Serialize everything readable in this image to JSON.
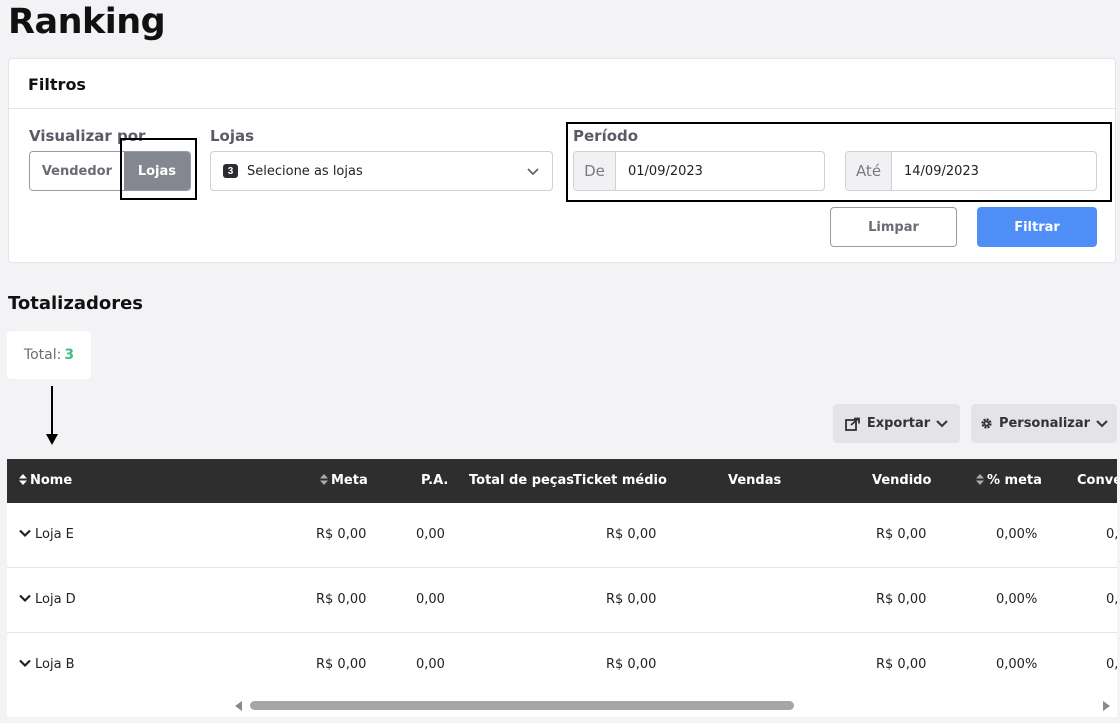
{
  "page": {
    "title": "Ranking"
  },
  "filters": {
    "header": "Filtros",
    "visualizar": {
      "label": "Visualizar por",
      "options": [
        "Vendedor",
        "Lojas"
      ],
      "selected": "Lojas"
    },
    "lojas": {
      "label": "Lojas",
      "count": "3",
      "placeholder": "Selecione as lojas"
    },
    "periodo": {
      "label": "Período",
      "from_prefix": "De",
      "from_value": "01/09/2023",
      "to_prefix": "Até",
      "to_value": "14/09/2023"
    },
    "clear_label": "Limpar",
    "filter_label": "Filtrar"
  },
  "totalizadores": {
    "title": "Totalizadores",
    "total_label": "Total:",
    "total_value": "3"
  },
  "toolbar": {
    "export_label": "Exportar",
    "customize_label": "Personalizar"
  },
  "table": {
    "headers": {
      "nome": "Nome",
      "meta": "Meta",
      "pa": "P.A.",
      "total_pecas": "Total de peças",
      "ticket_medio": "Ticket médio",
      "vendas": "Vendas",
      "vendido": "Vendido",
      "pct_meta": "% meta",
      "conversao": "Conve"
    },
    "rows": [
      {
        "nome": "Loja E",
        "meta": "R$ 0,00",
        "pa": "0,00",
        "ticket_medio": "R$ 0,00",
        "vendido": "R$ 0,00",
        "pct_meta": "0,00%",
        "conversao": "0,"
      },
      {
        "nome": "Loja D",
        "meta": "R$ 0,00",
        "pa": "0,00",
        "ticket_medio": "R$ 0,00",
        "vendido": "R$ 0,00",
        "pct_meta": "0,00%",
        "conversao": "0,"
      },
      {
        "nome": "Loja B",
        "meta": "R$ 0,00",
        "pa": "0,00",
        "ticket_medio": "R$ 0,00",
        "vendido": "R$ 0,00",
        "pct_meta": "0,00%",
        "conversao": "0,"
      }
    ]
  },
  "colors": {
    "accent": "#4f8ef7",
    "total_value": "#3fbf7f",
    "table_header": "#2e2e2e"
  }
}
